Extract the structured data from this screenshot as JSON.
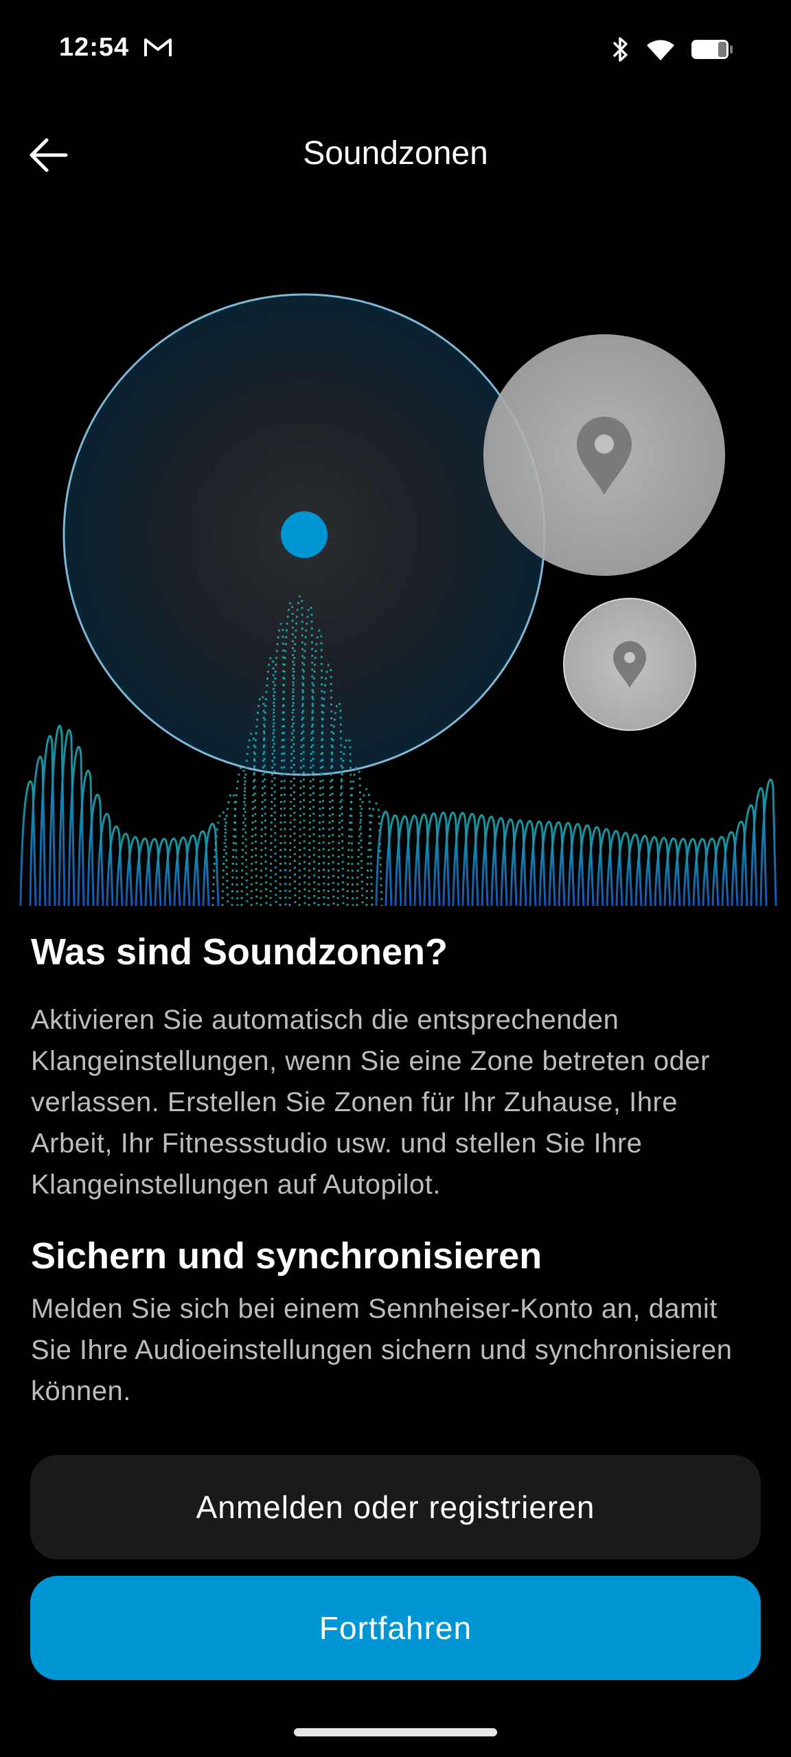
{
  "status_bar": {
    "time": "12:54",
    "icons": [
      "gmail-icon",
      "bluetooth-icon",
      "wifi-icon",
      "battery-icon"
    ]
  },
  "header": {
    "title": "Soundzonen",
    "back_icon": "arrow-left-icon"
  },
  "illustration": {
    "icons": [
      "location-pin-icon",
      "location-pin-icon"
    ],
    "colors": {
      "accent": "#0096d6",
      "zone_grey": "#bdbdbd"
    }
  },
  "section1": {
    "heading": "Was sind Soundzonen?",
    "body": "Aktivieren Sie automatisch die entsprechenden Klangeinstellungen, wenn Sie eine Zone betreten oder verlassen. Erstellen Sie Zonen für Ihr Zuhause, Ihre Arbeit, Ihr Fitnessstudio usw. und stellen Sie Ihre Klangeinstellungen auf Autopilot."
  },
  "section2": {
    "heading": "Sichern und synchronisieren",
    "body": "Melden Sie sich bei einem Sennheiser-Konto an, damit Sie Ihre Audioeinstellungen sichern und synchronisieren können."
  },
  "buttons": {
    "login": "Anmelden oder registrieren",
    "continue": "Fortfahren"
  }
}
